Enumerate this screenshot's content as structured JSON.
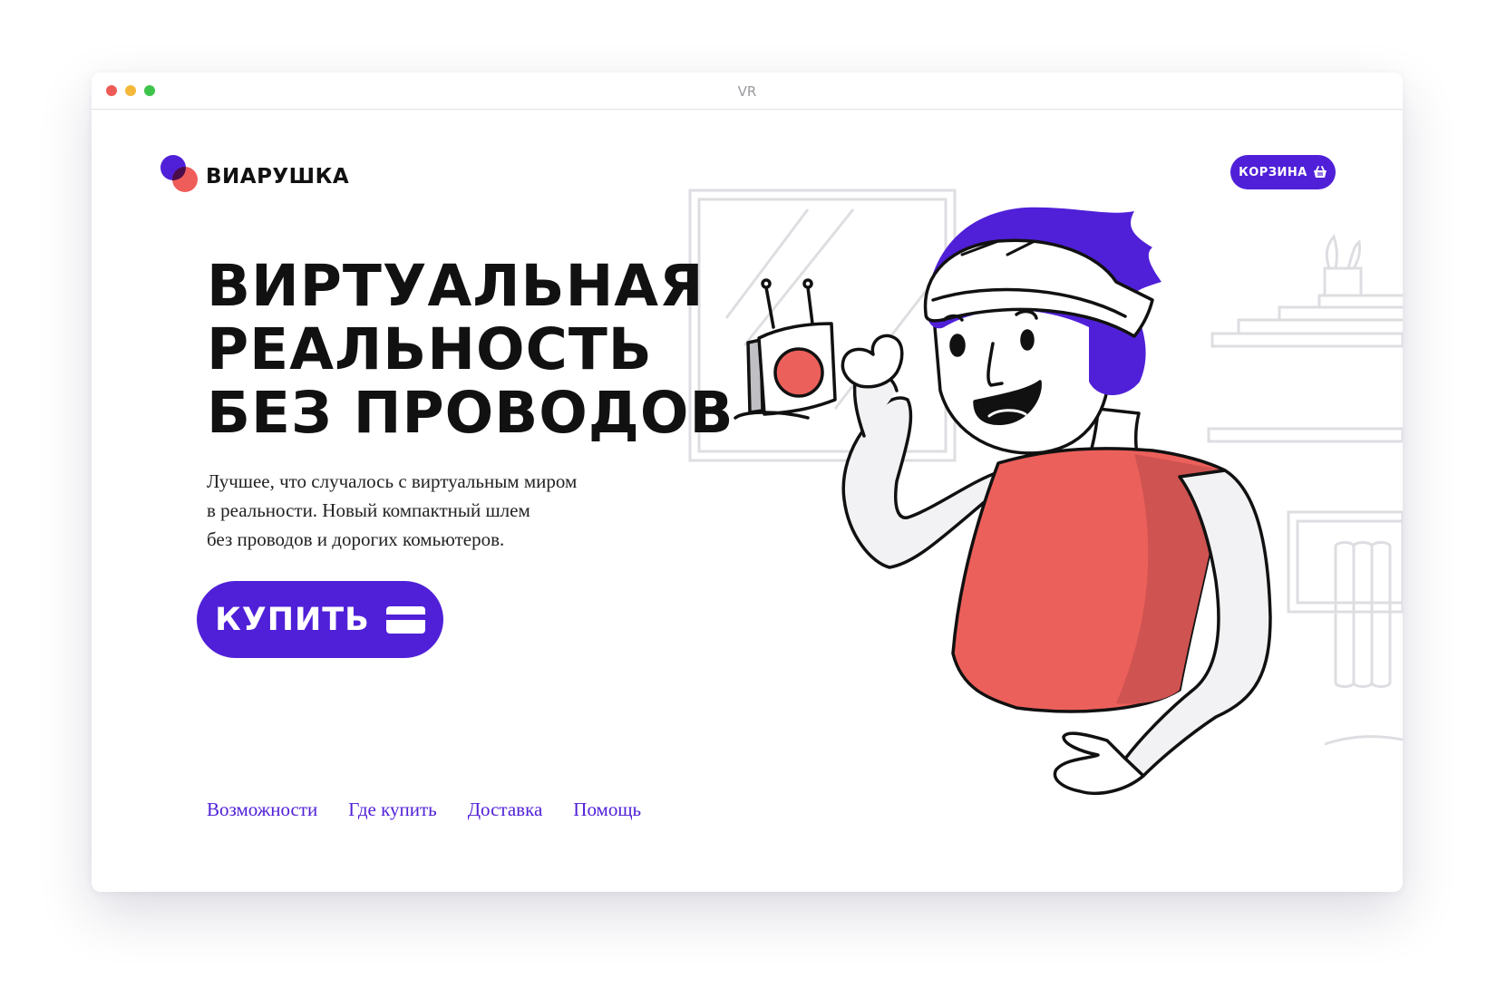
{
  "window": {
    "title": "VR"
  },
  "header": {
    "logo_text": "ВИАРУШКА",
    "cart_label": "КОРЗИНА",
    "cart_icon": "basket-icon"
  },
  "hero": {
    "title_lines": [
      "ВИРТУАЛЬНАЯ",
      "РЕАЛЬНОСТЬ",
      "БЕЗ ПРОВОДОВ"
    ],
    "description_lines": [
      "Лучшее, что случалось с виртуальным миром",
      "в реальности. Новый компактный шлем",
      "без проводов и дорогих комьютеров."
    ],
    "buy_label": "КУПИТЬ",
    "buy_icon": "credit-card-icon"
  },
  "nav": {
    "items": [
      {
        "label": "Возможности"
      },
      {
        "label": "Где купить"
      },
      {
        "label": "Доставка"
      },
      {
        "label": "Помощь"
      }
    ]
  },
  "colors": {
    "accent": "#5020d8",
    "coral": "#ee5d5a",
    "text": "#111111"
  }
}
